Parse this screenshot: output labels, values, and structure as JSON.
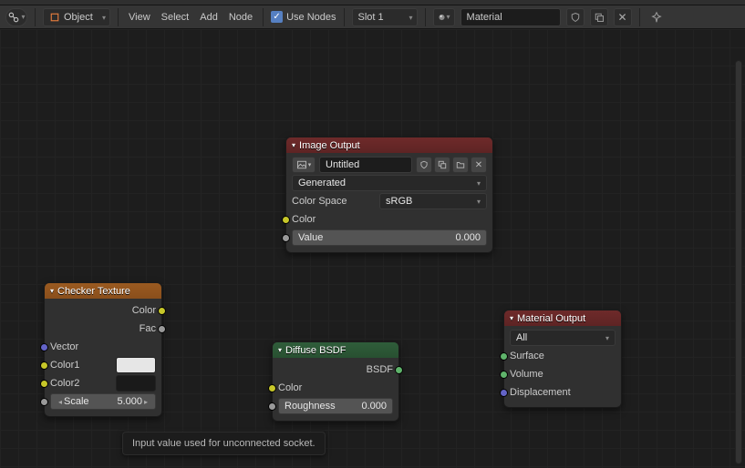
{
  "toolbar": {
    "mode_label": "Object",
    "menu": {
      "view": "View",
      "select": "Select",
      "add": "Add",
      "node": "Node"
    },
    "use_nodes_label": "Use Nodes",
    "use_nodes_checked": true,
    "slot_label": "Slot 1",
    "material_label": "Material"
  },
  "nodes": {
    "checker": {
      "title": "Checker Texture",
      "outputs": {
        "color": "Color",
        "fac": "Fac"
      },
      "inputs": {
        "vector": "Vector",
        "color1": "Color1",
        "color2": "Color2"
      },
      "scale_label": "Scale",
      "scale_value": "5.000",
      "color1_hex": "#e6e6e6",
      "color2_hex": "#1a1a1a"
    },
    "image_output": {
      "title": "Image Output",
      "image_name": "Untitled",
      "source_label": "Generated",
      "colorspace_label": "Color Space",
      "colorspace_value": "sRGB",
      "inputs": {
        "color": "Color"
      },
      "value_label": "Value",
      "value_value": "0.000"
    },
    "diffuse": {
      "title": "Diffuse BSDF",
      "outputs": {
        "bsdf": "BSDF"
      },
      "inputs": {
        "color": "Color"
      },
      "roughness_label": "Roughness",
      "roughness_value": "0.000"
    },
    "material_output": {
      "title": "Material Output",
      "target_label": "All",
      "inputs": {
        "surface": "Surface",
        "volume": "Volume",
        "displacement": "Displacement"
      }
    }
  },
  "tooltip": "Input value used for unconnected socket."
}
